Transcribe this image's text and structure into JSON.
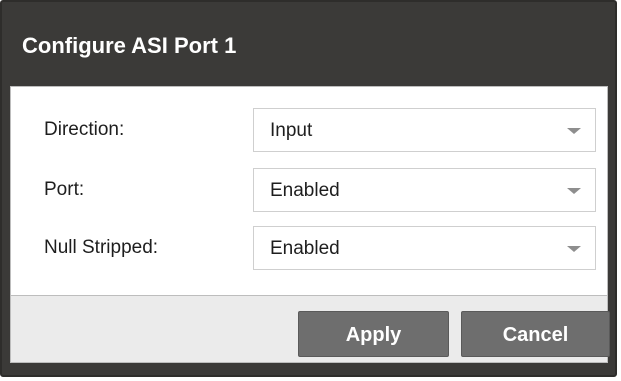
{
  "dialog": {
    "title": "Configure ASI Port 1"
  },
  "form": {
    "fields": [
      {
        "label": "Direction:",
        "value": "Input"
      },
      {
        "label": "Port:",
        "value": "Enabled"
      },
      {
        "label": "Null Stripped:",
        "value": "Enabled"
      }
    ]
  },
  "footer": {
    "apply_label": "Apply",
    "cancel_label": "Cancel"
  },
  "colors": {
    "titlebar": "#3b3a38",
    "button": "#6e6e6e",
    "footer": "#ebebeb"
  },
  "icons": {
    "dropdown": "caret-down-icon"
  }
}
